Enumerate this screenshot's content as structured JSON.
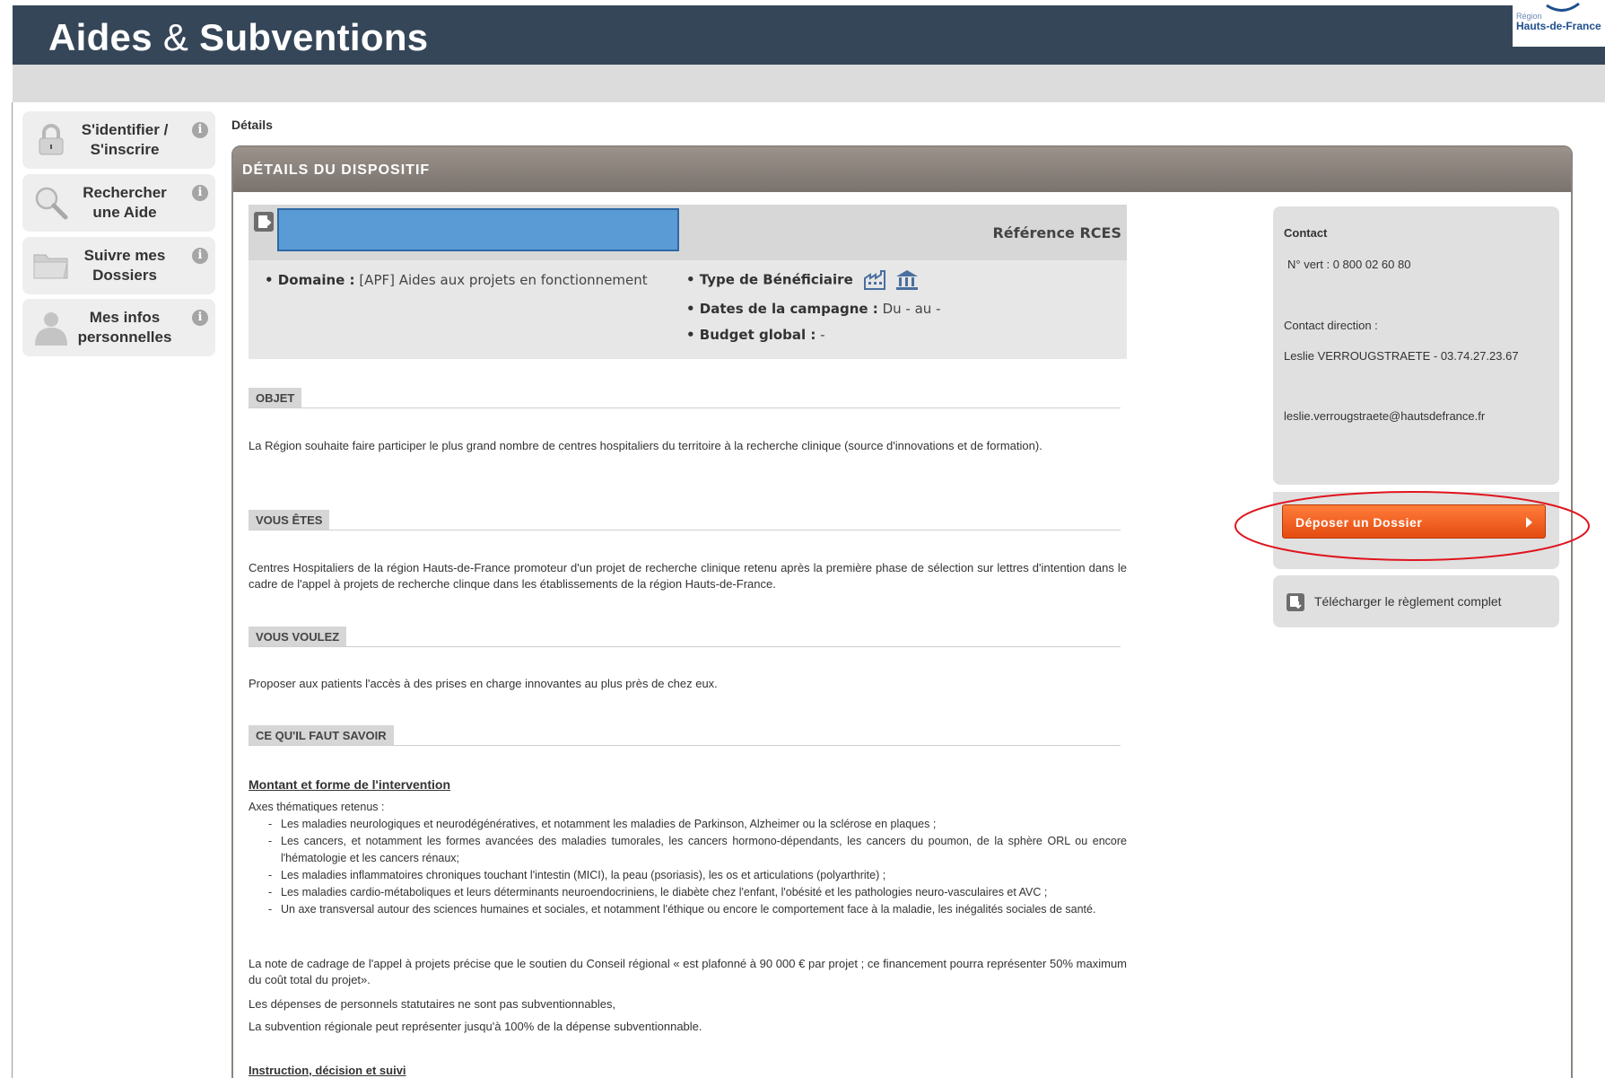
{
  "header": {
    "title_part1": "Aides ",
    "title_amp": "&",
    "title_part2": " Subventions",
    "logo_small": "Région",
    "logo_big": "Hauts-de-France"
  },
  "sidebar": {
    "items": [
      {
        "label_line1": "S'identifier /",
        "label_line2": "S'inscrire",
        "icon": "lock-icon"
      },
      {
        "label_line1": "Rechercher",
        "label_line2": "une Aide",
        "icon": "search-icon"
      },
      {
        "label_line1": "Suivre mes",
        "label_line2": "Dossiers",
        "icon": "folder-icon"
      },
      {
        "label_line1": "Mes infos",
        "label_line2": "personnelles",
        "icon": "user-icon"
      }
    ],
    "info_glyph": "i"
  },
  "breadcrumb": "Détails",
  "panel": {
    "title": "DÉTAILS DU DISPOSITIF",
    "reference": "Référence RCES",
    "domaine_label": "• Domaine :",
    "domaine_value": "[APF] Aides aux projets en fonctionnement",
    "beneficiaire_label": "• Type de Bénéficiaire",
    "dates_label": "• Dates de la campagne :",
    "dates_value": "Du - au -",
    "budget_label": "• Budget global :",
    "budget_value": "-"
  },
  "sections": {
    "objet": {
      "tag": "OBJET",
      "text": "La Région souhaite faire participer le plus grand nombre de centres hospitaliers du territoire à la recherche clinique (source d'innovations et de formation)."
    },
    "vous_etes": {
      "tag": "VOUS ÊTES",
      "text": "Centres Hospitaliers de la région Hauts-de-France promoteur d'un projet de recherche clinique retenu après la première phase de sélection sur lettres d'intention dans le cadre de l'appel à projets de recherche clinque dans les établissements de la région Hauts-de-France."
    },
    "vous_voulez": {
      "tag": "VOUS VOULEZ",
      "text": "Proposer aux patients l'accès à des prises en charge innovantes au plus près de chez eux."
    },
    "savoir": {
      "tag": "CE QU'IL FAUT SAVOIR",
      "subheading": "Montant et forme de l'intervention",
      "axes_intro": "Axes thématiques retenus :",
      "axes": [
        "Les maladies neurologiques et neurodégénératives, et notamment les maladies de Parkinson, Alzheimer ou la sclérose en plaques ;",
        "Les cancers, et notamment les formes avancées des maladies tumorales, les cancers hormono-dépendants, les cancers du poumon, de la sphère ORL ou encore l'hématologie et les cancers rénaux;",
        "Les maladies inflammatoires chroniques touchant l'intestin (MICI), la peau (psoriasis), les os et articulations (polyarthrite) ;",
        "Les maladies cardio-métaboliques et leurs déterminants neuroendocriniens, le diabète chez l'enfant, l'obésité et les pathologies neuro-vasculaires et AVC ;",
        "Un axe transversal autour des sciences humaines et sociales, et notamment l'éthique ou encore le comportement face à la maladie, les inégalités sociales de santé."
      ],
      "para1": "La note de cadrage de l'appel à projets précise que le soutien du Conseil régional « est plafonné à 90 000 € par projet ; ce financement pourra représenter 50% maximum du coût total du projet».",
      "para2": "Les dépenses de personnels statutaires ne sont pas subventionnables,",
      "para3": "La subvention régionale peut représenter jusqu'à 100% de la dépense subventionnable.",
      "subheading2": "Instruction, décision et suivi"
    }
  },
  "contact": {
    "title": "Contact",
    "phone": "N° vert : 0 800 02 60 80",
    "direction_label": "Contact direction :",
    "direction_value": "Leslie VERROUGSTRAETE - 03.74.27.23.67",
    "email": "leslie.verrougstraete@hautsdefrance.fr"
  },
  "actions": {
    "deposit_label": "Déposer un Dossier",
    "download_label": "Télécharger le règlement complet"
  },
  "colors": {
    "header_bg": "#354658",
    "accent_orange": "#e44b10",
    "highlight_red": "#e0141e"
  }
}
